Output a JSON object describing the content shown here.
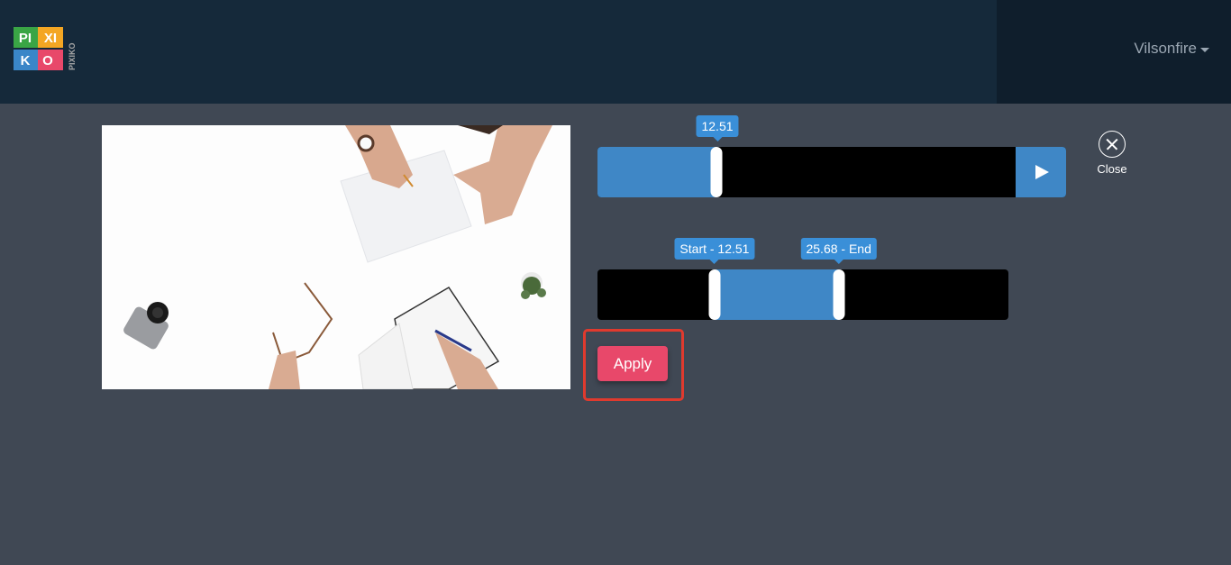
{
  "header": {
    "logo": {
      "letters": [
        "PI",
        "XI",
        "K",
        "O"
      ],
      "side_text": "PIXIKO",
      "colors": {
        "green": "#3aa545",
        "orange": "#f4a623",
        "blue": "#3a86c8",
        "red": "#e8486a"
      }
    },
    "user_menu_label": "Vilsonfire"
  },
  "preview": {
    "description": "Overhead photo of a white desk with hands writing on paper, notebook, glasses, camera and plant"
  },
  "player": {
    "position_label": "12.51",
    "position_fraction": 0.285,
    "play_icon": "play-icon"
  },
  "close": {
    "label": "Close"
  },
  "trim": {
    "start_label": "Start - 12.51",
    "end_label": "25.68 - End",
    "start_fraction": 0.285,
    "end_fraction": 0.587
  },
  "apply": {
    "label": "Apply"
  },
  "colors": {
    "accent": "#3f87c6",
    "tooltip": "#3a8fd8",
    "apply": "#e8486a",
    "highlight": "#e03a2e",
    "background": "#404854",
    "header": "#15293a"
  }
}
